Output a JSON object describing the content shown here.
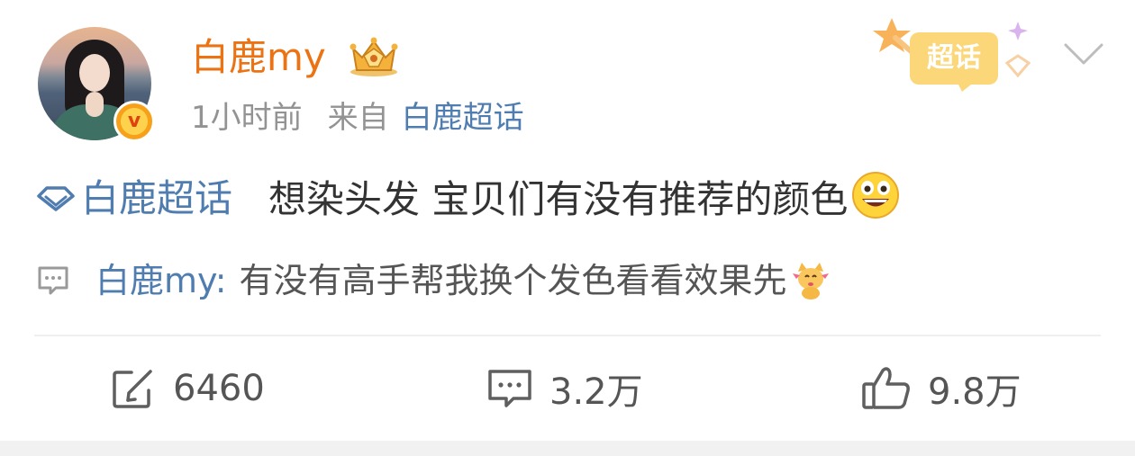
{
  "post": {
    "author": {
      "name": "白鹿my",
      "verified_icon": "v-badge",
      "crown_icon": "gold-crown-badge"
    },
    "meta": {
      "time": "1小时前",
      "source_label": "来自",
      "source": "白鹿超话"
    },
    "supertopic_badge": {
      "label": "超话"
    },
    "topic_tag": "白鹿超话",
    "text": "想染头发 宝贝们有没有推荐的颜色",
    "text_emoji": "grinning-face-emoji",
    "repost": {
      "user": "白鹿my:",
      "text": "有没有高手帮我换个发色看看效果先",
      "emoji": "cat-emoji"
    },
    "actions": {
      "repost_count": "6460",
      "comment_count": "3.2万",
      "like_count": "9.8万"
    }
  },
  "colors": {
    "username": "#eb7314",
    "link": "#507daf",
    "meta": "#939393",
    "text": "#333333"
  }
}
